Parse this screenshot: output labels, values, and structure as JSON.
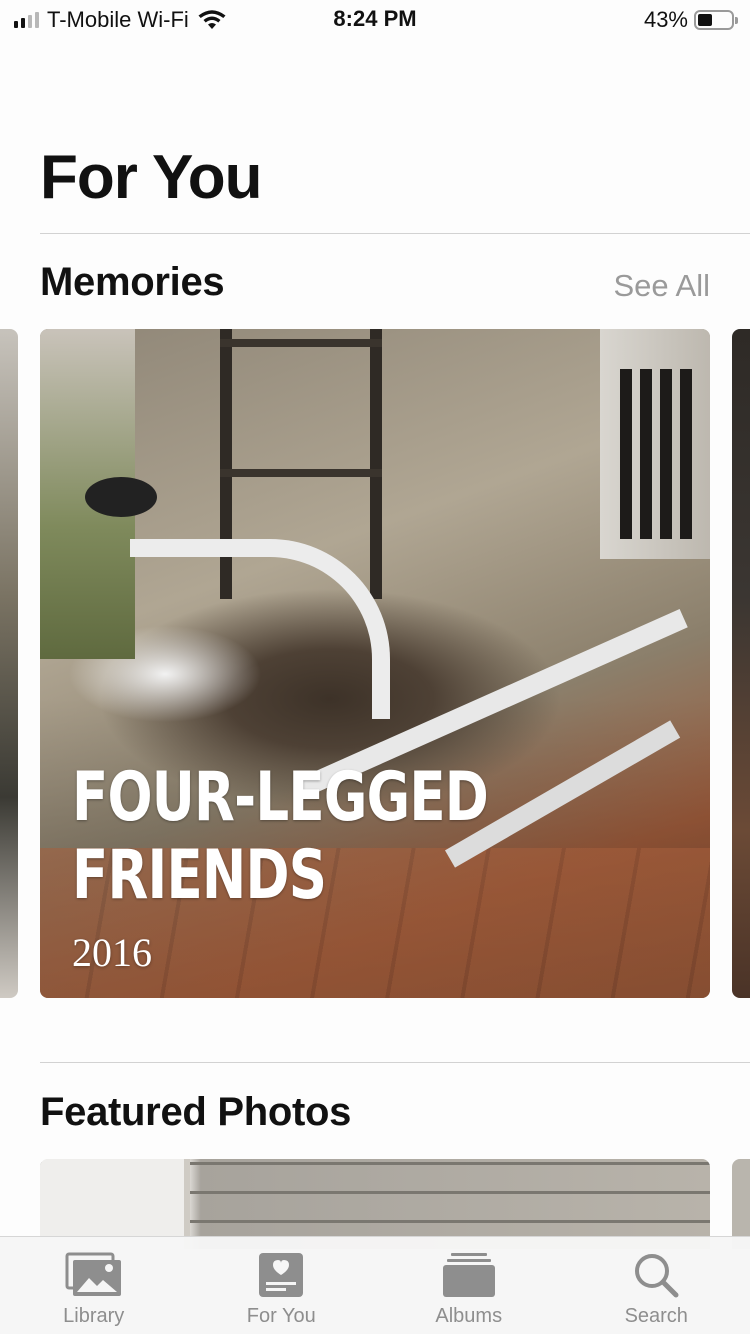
{
  "status_bar": {
    "carrier": "T-Mobile Wi-Fi",
    "time": "8:24 PM",
    "battery_percent": "43%",
    "battery_level": 0.43,
    "signal_bars_filled": 2,
    "signal_bars_total": 4
  },
  "page": {
    "title": "For You"
  },
  "memories": {
    "section_title": "Memories",
    "see_all_label": "See All",
    "cards": [
      {
        "title_line1": "FOUR-LEGGED",
        "title_line2": "FRIENDS",
        "year": "2016"
      }
    ]
  },
  "featured": {
    "section_title": "Featured Photos"
  },
  "tab_bar": {
    "tabs": [
      {
        "label": "Library",
        "icon": "photo-library-icon"
      },
      {
        "label": "For You",
        "icon": "for-you-icon"
      },
      {
        "label": "Albums",
        "icon": "albums-icon"
      },
      {
        "label": "Search",
        "icon": "search-icon"
      }
    ]
  },
  "colors": {
    "tab_icon_gray": "#8e8e8e",
    "see_all_gray": "#9a9a9a",
    "text": "#111111"
  }
}
